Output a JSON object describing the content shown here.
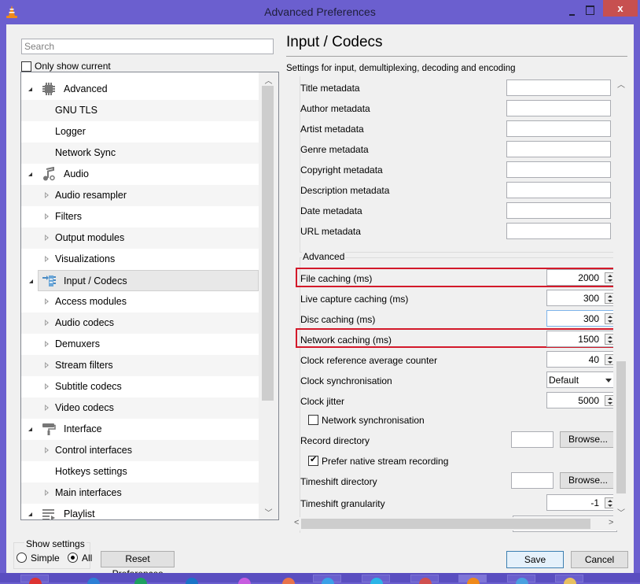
{
  "window": {
    "title": "Advanced Preferences",
    "close_label": "x"
  },
  "sidebar": {
    "search_placeholder": "Search",
    "only_show_current_label": "Only show current",
    "only_show_current_checked": false,
    "tree": [
      {
        "label": "Advanced",
        "level": 0,
        "icon": "cpu-chip-icon",
        "expanded": true
      },
      {
        "label": "GNU TLS",
        "level": 1,
        "has_children": false
      },
      {
        "label": "Logger",
        "level": 1,
        "has_children": false
      },
      {
        "label": "Network Sync",
        "level": 1,
        "has_children": false
      },
      {
        "label": "Audio",
        "level": 0,
        "icon": "music-note-icon",
        "expanded": true
      },
      {
        "label": "Audio resampler",
        "level": 1,
        "has_children": true
      },
      {
        "label": "Filters",
        "level": 1,
        "has_children": true
      },
      {
        "label": "Output modules",
        "level": 1,
        "has_children": true
      },
      {
        "label": "Visualizations",
        "level": 1,
        "has_children": true
      },
      {
        "label": "Input / Codecs",
        "level": 0,
        "icon": "input-codecs-icon",
        "expanded": true,
        "selected": true
      },
      {
        "label": "Access modules",
        "level": 1,
        "has_children": true
      },
      {
        "label": "Audio codecs",
        "level": 1,
        "has_children": true
      },
      {
        "label": "Demuxers",
        "level": 1,
        "has_children": true
      },
      {
        "label": "Stream filters",
        "level": 1,
        "has_children": true
      },
      {
        "label": "Subtitle codecs",
        "level": 1,
        "has_children": true
      },
      {
        "label": "Video codecs",
        "level": 1,
        "has_children": true
      },
      {
        "label": "Interface",
        "level": 0,
        "icon": "paint-roller-icon",
        "expanded": true
      },
      {
        "label": "Control interfaces",
        "level": 1,
        "has_children": true
      },
      {
        "label": "Hotkeys settings",
        "level": 1,
        "has_children": false
      },
      {
        "label": "Main interfaces",
        "level": 1,
        "has_children": true
      },
      {
        "label": "Playlist",
        "level": 0,
        "icon": "playlist-icon",
        "expanded": true
      }
    ]
  },
  "show_settings": {
    "legend": "Show settings",
    "options": [
      {
        "label": "Simple",
        "selected": false
      },
      {
        "label": "All",
        "selected": true
      }
    ]
  },
  "reset_button_label": "Reset Preferences",
  "panel": {
    "title": "Input / Codecs",
    "subtitle": "Settings for input, demultiplexing, decoding and encoding",
    "metadata_fields": [
      {
        "label": "Title metadata",
        "value": ""
      },
      {
        "label": "Author metadata",
        "value": ""
      },
      {
        "label": "Artist metadata",
        "value": ""
      },
      {
        "label": "Genre metadata",
        "value": ""
      },
      {
        "label": "Copyright metadata",
        "value": ""
      },
      {
        "label": "Description metadata",
        "value": ""
      },
      {
        "label": "Date metadata",
        "value": ""
      },
      {
        "label": "URL metadata",
        "value": ""
      }
    ],
    "advanced": {
      "legend": "Advanced",
      "file_caching": {
        "label": "File caching (ms)",
        "value": "2000",
        "highlighted": true
      },
      "live_capture_caching": {
        "label": "Live capture caching (ms)",
        "value": "300"
      },
      "disc_caching": {
        "label": "Disc caching (ms)",
        "value": "300"
      },
      "network_caching": {
        "label": "Network caching (ms)",
        "value": "1500",
        "highlighted": true
      },
      "clock_ref_avg_counter": {
        "label": "Clock reference average counter",
        "value": "40"
      },
      "clock_sync": {
        "label": "Clock synchronisation",
        "value": "Default"
      },
      "clock_jitter": {
        "label": "Clock jitter",
        "value": "5000"
      },
      "network_sync": {
        "label": "Network synchronisation",
        "checked": false
      },
      "record_directory": {
        "label": "Record directory",
        "value": "",
        "browse_label": "Browse..."
      },
      "prefer_native_recording": {
        "label": "Prefer native stream recording",
        "checked": true
      },
      "timeshift_directory": {
        "label": "Timeshift directory",
        "value": "",
        "browse_label": "Browse..."
      },
      "timeshift_granularity": {
        "label": "Timeshift granularity",
        "value": "-1"
      }
    }
  },
  "footer": {
    "save_label": "Save",
    "cancel_label": "Cancel"
  },
  "colors": {
    "titlebar": "#6b5fcf",
    "close_button": "#c75050",
    "highlight_box": "#d3192a"
  }
}
